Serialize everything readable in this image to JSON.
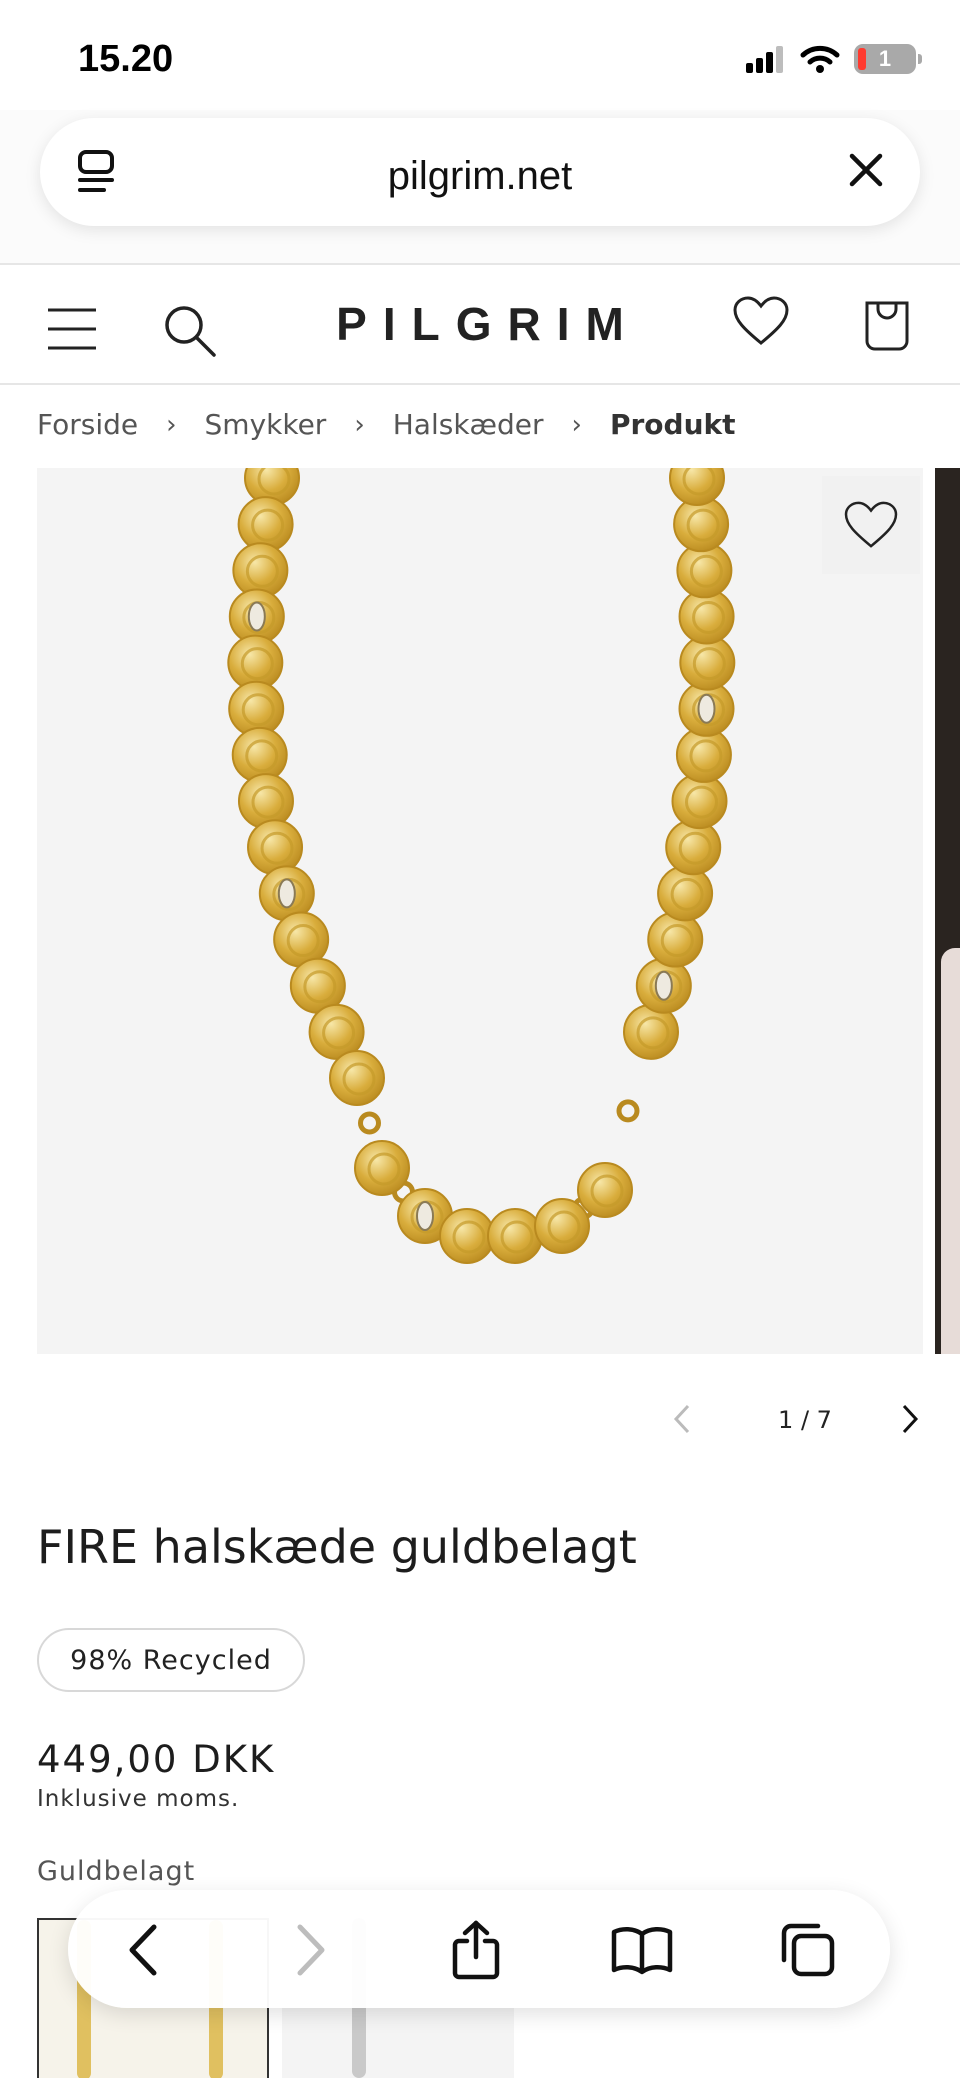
{
  "status_bar": {
    "time": "15.20",
    "battery_level": "1"
  },
  "browser": {
    "url": "pilgrim.net"
  },
  "site": {
    "logo": "PILGRIM"
  },
  "breadcrumb": {
    "items": [
      "Forside",
      "Smykker",
      "Halskæder"
    ],
    "current": "Produkt"
  },
  "gallery": {
    "counter": "1 / 7"
  },
  "product": {
    "title": "FIRE halskæde guldbelagt",
    "badge": "98% Recycled",
    "price": "449,00 DKK",
    "tax_note": "Inklusive moms.",
    "variant_label": "Guldbelagt"
  },
  "colors": {
    "gold": "#d9ad3c",
    "gold_dark": "#b98a1f",
    "gallery_bg": "#f4f4f4",
    "text": "#1d1d1d"
  },
  "icons": {
    "url_left": "tab-list-icon",
    "url_close": "close-icon",
    "menu": "hamburger-menu-icon",
    "search": "search-icon",
    "wishlist": "heart-icon",
    "bag": "shopping-bag-icon",
    "toolbar": [
      "back-arrow-icon",
      "forward-arrow-icon",
      "share-icon",
      "bookmarks-icon",
      "tabs-icon"
    ]
  }
}
